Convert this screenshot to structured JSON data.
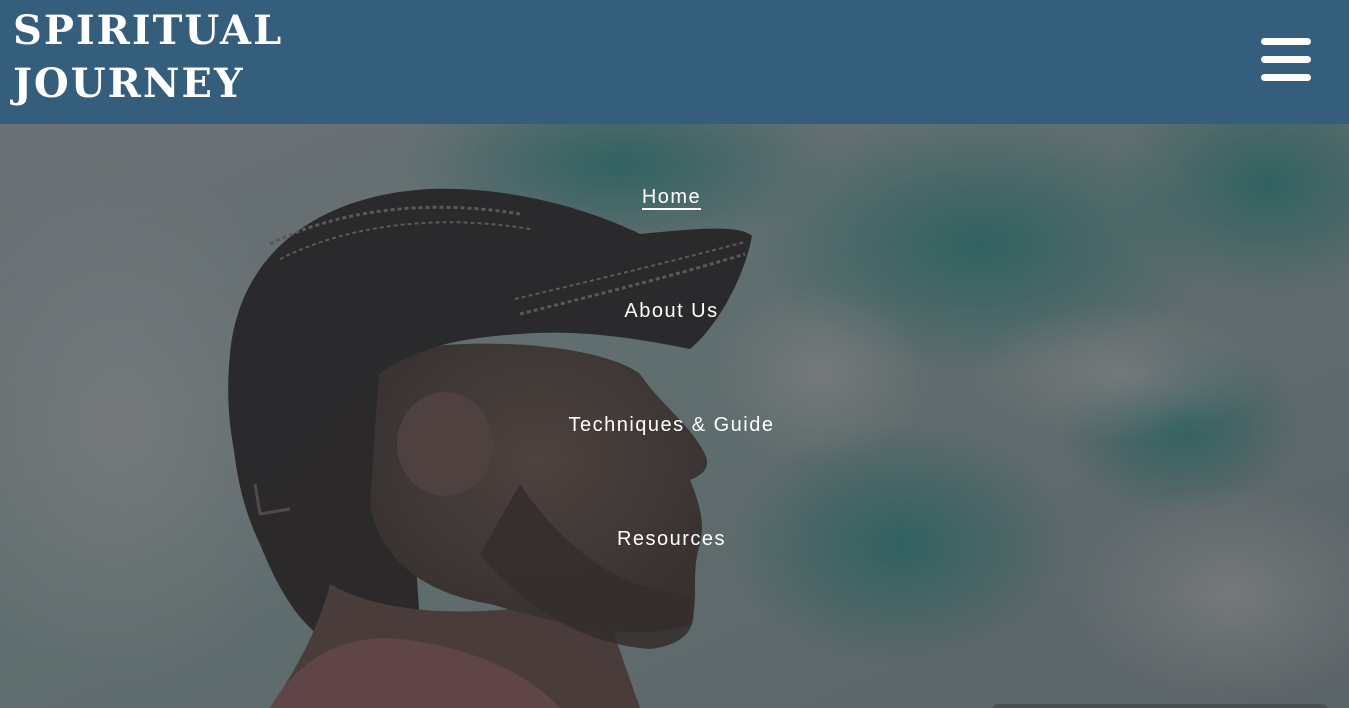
{
  "header": {
    "logo_line1": "SPIRITUAL",
    "logo_line2": "JOURNEY",
    "menu_icon": "hamburger-menu-icon",
    "background_color": "#355d7c"
  },
  "nav": {
    "items": [
      {
        "label": "Home",
        "active": true
      },
      {
        "label": "About Us",
        "active": false
      },
      {
        "label": "Techniques & Guide",
        "active": false
      },
      {
        "label": "Resources",
        "active": false
      }
    ]
  },
  "hero": {
    "image": "man-with-cap-looking-at-sky-photo"
  }
}
